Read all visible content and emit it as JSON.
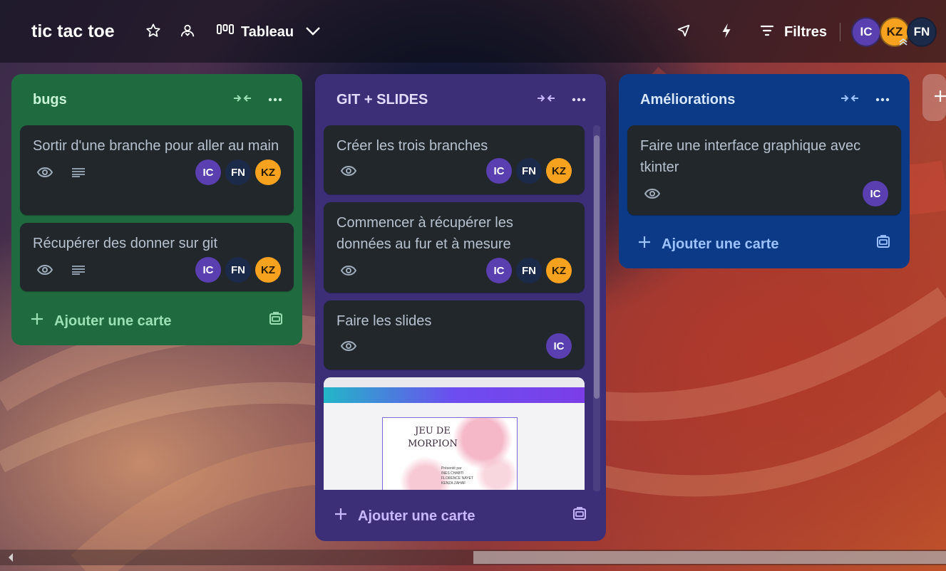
{
  "board": {
    "title": "tic tac toe",
    "view_label": "Tableau",
    "filters_label": "Filtres",
    "members": [
      {
        "initials": "IC",
        "color": "#5a3fb0"
      },
      {
        "initials": "KZ",
        "color": "#f6a21e"
      },
      {
        "initials": "FN",
        "color": "#1c2a4a"
      }
    ]
  },
  "lists": [
    {
      "title": "bugs",
      "add_card_label": "Ajouter une carte",
      "cards": [
        {
          "title": "Sortir d'une branche pour aller au main",
          "members": [
            "IC",
            "FN",
            "KZ"
          ],
          "watch": true,
          "description": true
        },
        {
          "title": "Récupérer des donner sur git",
          "members": [
            "IC",
            "FN",
            "KZ"
          ],
          "watch": true,
          "description": true
        }
      ]
    },
    {
      "title": "GIT + SLIDES",
      "add_card_label": "Ajouter une carte",
      "cards": [
        {
          "title": "Créer les trois branches",
          "members": [
            "IC",
            "FN",
            "KZ"
          ],
          "watch": true
        },
        {
          "title": "Commencer à récupérer les données au fur et à mesure",
          "members": [
            "IC",
            "FN",
            "KZ"
          ],
          "watch": true
        },
        {
          "title": "Faire les slides",
          "members": [
            "IC"
          ],
          "watch": true
        }
      ],
      "cover_card": {
        "slide_title": "JEU DE MORPION",
        "slide_presented_by": "Présenté par",
        "slide_authors": [
          "INES CHABTI",
          "FLORENCE NAYET",
          "KENZA ZAHAF"
        ]
      }
    },
    {
      "title": "Améliorations",
      "add_card_label": "Ajouter une carte",
      "cards": [
        {
          "title": "Faire une interface graphique avec tkinter",
          "members": [
            "IC"
          ],
          "watch": true
        }
      ]
    }
  ],
  "icons": {
    "star": "star-icon",
    "visibility": "team-visibility-icon",
    "board_view": "board-view-icon",
    "power_ups": "rocket-icon",
    "automation": "lightning-icon",
    "filter": "filter-icon",
    "collapse": "collapse-list-icon",
    "more": "more-icon",
    "watch": "eye-icon",
    "description": "description-icon",
    "add": "plus-icon",
    "template": "card-template-icon"
  }
}
